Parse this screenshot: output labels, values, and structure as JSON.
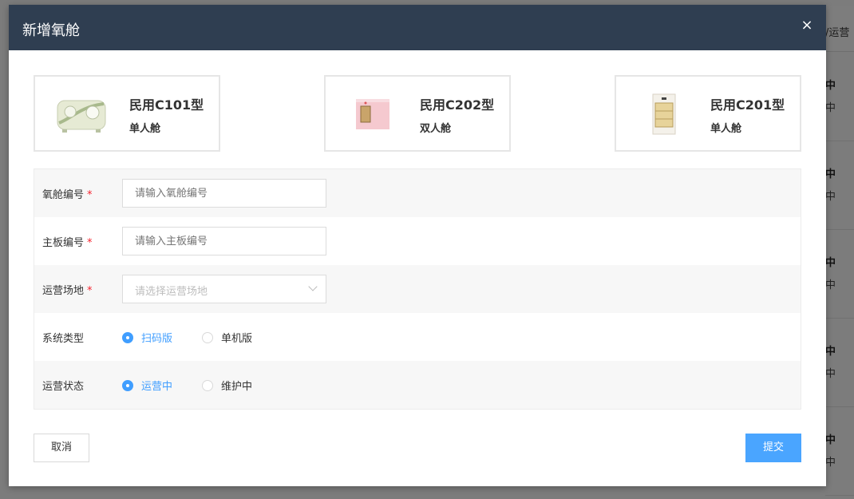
{
  "background": {
    "header_text": "/运营",
    "rows": [
      {
        "status": "中",
        "sub": "中"
      },
      {
        "status": "中",
        "sub": "中"
      },
      {
        "status": "中",
        "sub": "中"
      },
      {
        "status": "中",
        "sub": "中"
      },
      {
        "status": "中",
        "sub": "中"
      }
    ]
  },
  "modal": {
    "title": "新增氧舱",
    "close_icon": "×"
  },
  "products": [
    {
      "name": "民用C101型",
      "type": "单人舱",
      "icon": "capsule-c101-image"
    },
    {
      "name": "民用C202型",
      "type": "双人舱",
      "icon": "capsule-c202-image"
    },
    {
      "name": "民用C201型",
      "type": "单人舱",
      "icon": "capsule-c201-image"
    }
  ],
  "form": {
    "cabin_no": {
      "label": "氧舱编号",
      "required": "*",
      "placeholder": "请输入氧舱编号"
    },
    "board_no": {
      "label": "主板编号",
      "required": "*",
      "placeholder": "请输入主板编号"
    },
    "site": {
      "label": "运营场地",
      "required": "*",
      "placeholder": "请选择运营场地"
    },
    "system_type": {
      "label": "系统类型",
      "options": [
        "扫码版",
        "单机版"
      ],
      "selected": "扫码版"
    },
    "op_status": {
      "label": "运营状态",
      "options": [
        "运营中",
        "维护中"
      ],
      "selected": "运营中"
    }
  },
  "buttons": {
    "cancel": "取消",
    "submit": "提交"
  },
  "colors": {
    "header_bg": "#2f3e51",
    "accent": "#409eff",
    "submit_bg": "#4aa5ff",
    "required": "#f5222d"
  }
}
